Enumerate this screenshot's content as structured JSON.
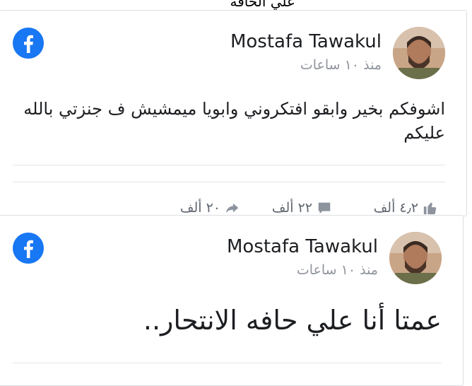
{
  "top_cut_text": "علي الحافه",
  "posts": [
    {
      "author": "Mostafa Tawakul",
      "time": "منذ ١٠ ساعات",
      "text": "اشوفكم بخير وابقو افتكروني وابويا ميمشيش ف جنزتي بالله عليكم",
      "likes": "٤٫٢ ألف",
      "comments": "٢٢ ألف",
      "shares": "٢٠ ألف"
    },
    {
      "author": "Mostafa Tawakul",
      "time": "منذ ١٠ ساعات",
      "text": "عمتا أنا علي حافه الانتحار.."
    }
  ],
  "colors": {
    "facebook_blue": "#1877f2",
    "meta_text": "#90949c"
  },
  "icons": {
    "logo": "facebook-logo-icon",
    "like": "thumbs-up-icon",
    "comment": "comment-icon",
    "share": "share-icon"
  }
}
